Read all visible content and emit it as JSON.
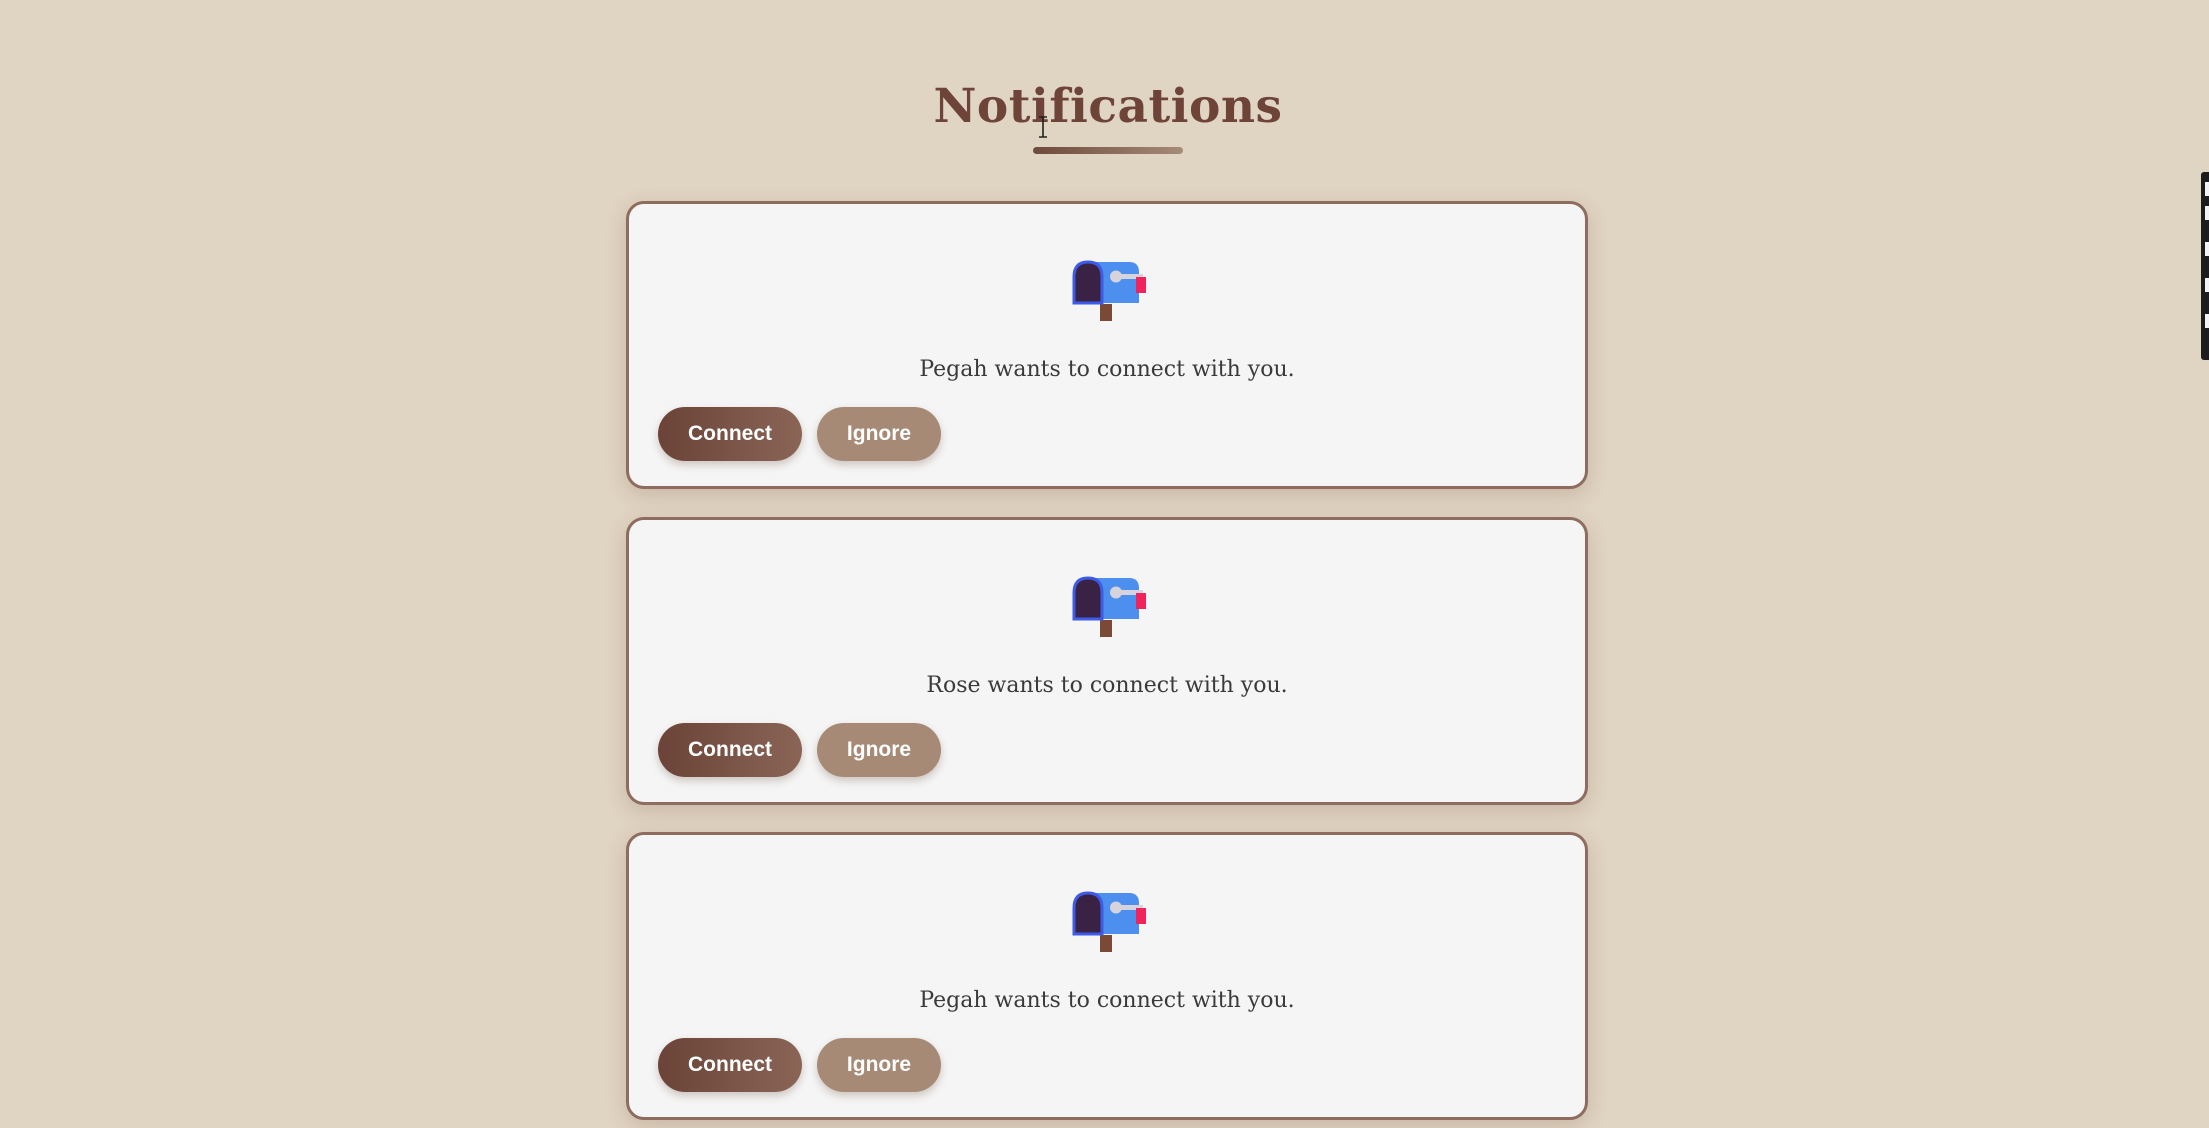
{
  "page": {
    "title": "Notifications"
  },
  "notifications": [
    {
      "icon": "mailbox-icon",
      "message": "Pegah wants to connect with you.",
      "connect_label": "Connect",
      "ignore_label": "Ignore"
    },
    {
      "icon": "mailbox-icon",
      "message": "Rose wants to connect with you.",
      "connect_label": "Connect",
      "ignore_label": "Ignore"
    },
    {
      "icon": "mailbox-icon",
      "message": "Pegah wants to connect with you.",
      "connect_label": "Connect",
      "ignore_label": "Ignore"
    }
  ],
  "colors": {
    "background": "#e0d4c2",
    "title": "#6e4439",
    "card_background": "#f5f5f5",
    "card_border": "#8e6c60",
    "connect_button": "#6b4338",
    "ignore_button": "#a68a76"
  }
}
